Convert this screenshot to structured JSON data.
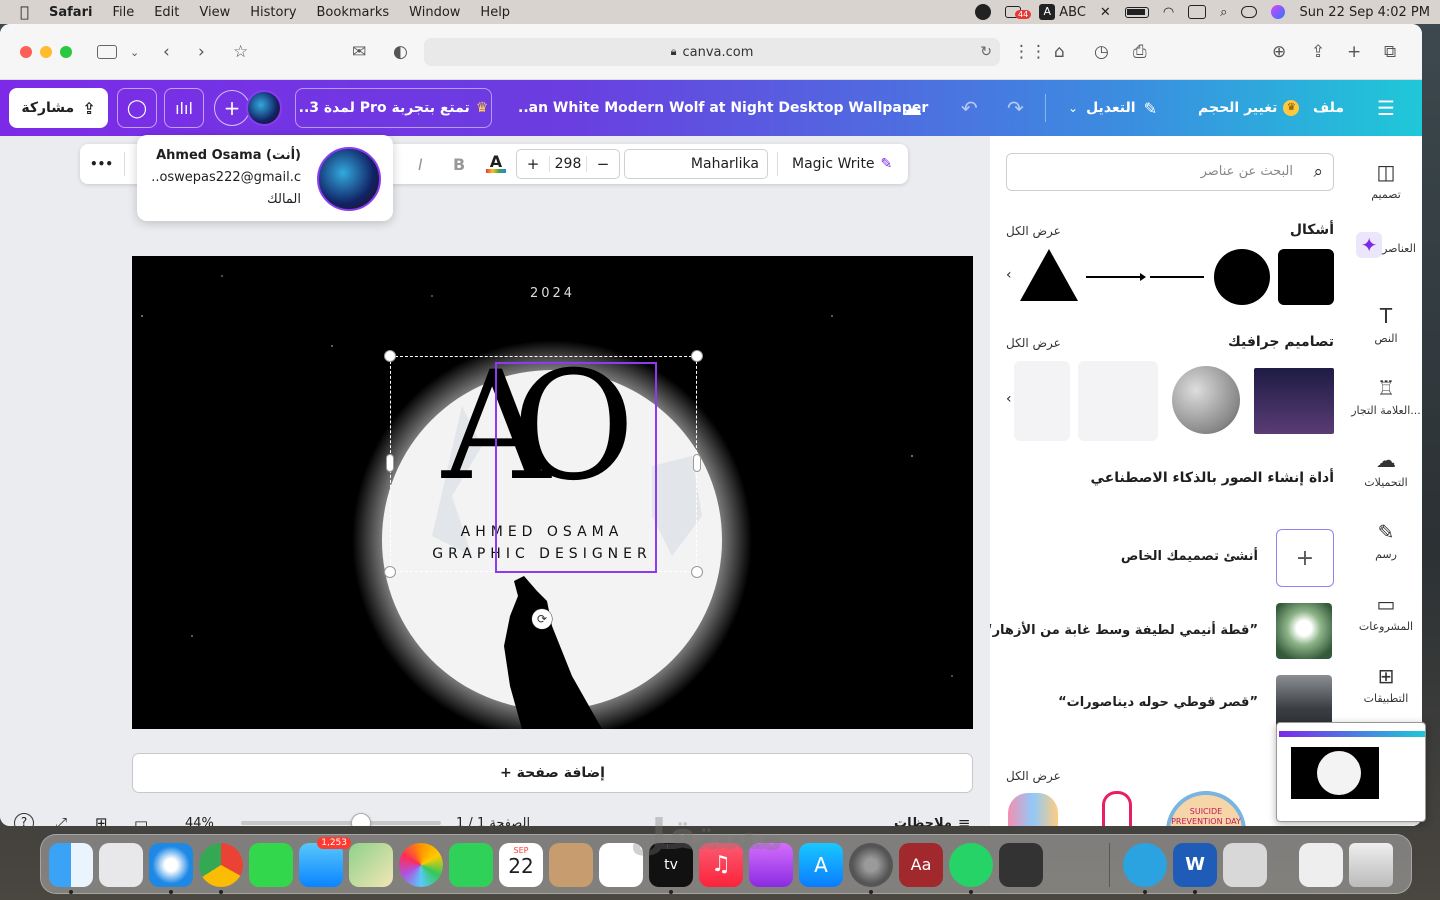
{
  "menubar": {
    "apple": "",
    "app": "Safari",
    "items": [
      "File",
      "Edit",
      "View",
      "History",
      "Bookmarks",
      "Window",
      "Help"
    ],
    "badge": "44",
    "input_method": "ABC",
    "datetime": "Sun 22 Sep  4:02 PM"
  },
  "safari": {
    "url": "canva.com"
  },
  "canva_header": {
    "menu_label": "ملف",
    "resize_label": "تغيير الحجم",
    "edit_label": "التعديل",
    "title": "..an White Modern Wolf at Night Desktop Wallpaper",
    "pro_label": "تمتع بتجربة Pro لمدة 3..",
    "share_label": "مشاركة"
  },
  "toolbar": {
    "magic_write": "Magic Write",
    "font": "Maharlika",
    "font_size": "298",
    "minus": "−",
    "plus": "+",
    "more": "•••"
  },
  "popup": {
    "name": "Ahmed Osama (أنت)",
    "email": "..oswepas222@gmail.c",
    "role": "المالك"
  },
  "canvas": {
    "year": "2024",
    "monogram_a": "A",
    "monogram_o": "O",
    "line1": "AHMED OSAMA",
    "line2": "GRAPHIC DESIGNER"
  },
  "add_page": "+ إضافة صفحة",
  "footer": {
    "zoom": "44%",
    "page": "الصفحة 1 / 1",
    "notes": "ملاحظات",
    "zoom_fraction": 0.6
  },
  "side_panel": {
    "search_placeholder": "البحث عن عناصر",
    "shapes_title": "أشكال",
    "see_all": "عرض الكل",
    "graphics_title": "تصاميم جرافيك",
    "ai_title": "أداة إنشاء الصور بالذكاء الاصطناعي",
    "create_own": "أنشئ تصميمك الخاص",
    "prompt1": "“قطة أنيمي لطيفة وسط غابة من الأزهار”",
    "prompt2": "“قصر قوطي حوله ديناصورات”",
    "suicide_badge": "SUICIDE PREVENTION DAY"
  },
  "rail": {
    "items": [
      "تصميم",
      "العناصر",
      "النص",
      "العلامة التجار...",
      "التحميلات",
      "رسم",
      "المشروعات",
      "التطبيقات"
    ]
  },
  "dock": {
    "mail_badge": "1,253",
    "cal_month": "SEP",
    "cal_day": "22",
    "tv_label": "tv",
    "dict_label": "Aa"
  },
  "watermark": "مستقل"
}
